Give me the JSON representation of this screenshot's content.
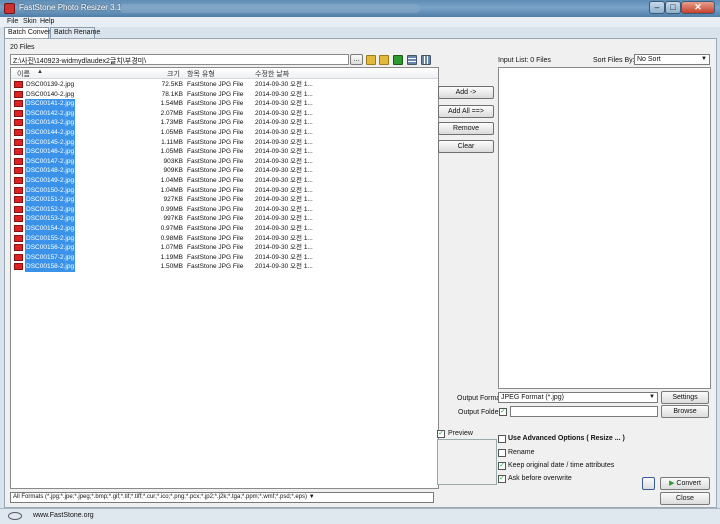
{
  "window": {
    "title": "FastStone Photo Resizer 3.1",
    "close_glyph": "✕",
    "min_glyph": "–",
    "max_glyph": "□"
  },
  "menu": [
    "File",
    "Skin",
    "Help"
  ],
  "tabs": [
    "Batch Convert",
    "Batch Rename"
  ],
  "file_count": "20 Files",
  "path": "Z:\\사진\\140923-widmydlaudex2글치\\부경미\\",
  "browse_label": "...",
  "columns": {
    "name": "이름",
    "size": "크기",
    "type": "항목 유형",
    "date": "수정한 날짜",
    "sort_glyph": "▲"
  },
  "files": [
    {
      "name": "DSC00139-2.jpg",
      "size": "72.5KB",
      "type": "FastStone JPG File",
      "date": "2014-09-30 오전 1...",
      "selected": false
    },
    {
      "name": "DSC00140-2.jpg",
      "size": "78.1KB",
      "type": "FastStone JPG File",
      "date": "2014-09-30 오전 1...",
      "selected": false
    },
    {
      "name": "DSC00141-2.jpg",
      "size": "1.54MB",
      "type": "FastStone JPG File",
      "date": "2014-09-30 오전 1...",
      "selected": true
    },
    {
      "name": "DSC00142-2.jpg",
      "size": "2.07MB",
      "type": "FastStone JPG File",
      "date": "2014-09-30 오전 1...",
      "selected": true
    },
    {
      "name": "DSC00143-2.jpg",
      "size": "1.73MB",
      "type": "FastStone JPG File",
      "date": "2014-09-30 오전 1...",
      "selected": true
    },
    {
      "name": "DSC00144-2.jpg",
      "size": "1.05MB",
      "type": "FastStone JPG File",
      "date": "2014-09-30 오전 1...",
      "selected": true
    },
    {
      "name": "DSC00145-2.jpg",
      "size": "1.11MB",
      "type": "FastStone JPG File",
      "date": "2014-09-30 오전 1...",
      "selected": true
    },
    {
      "name": "DSC00146-2.jpg",
      "size": "1.05MB",
      "type": "FastStone JPG File",
      "date": "2014-09-30 오전 1...",
      "selected": true
    },
    {
      "name": "DSC00147-2.jpg",
      "size": "903KB",
      "type": "FastStone JPG File",
      "date": "2014-09-30 오전 1...",
      "selected": true
    },
    {
      "name": "DSC00148-2.jpg",
      "size": "909KB",
      "type": "FastStone JPG File",
      "date": "2014-09-30 오전 1...",
      "selected": true
    },
    {
      "name": "DSC00149-2.jpg",
      "size": "1.04MB",
      "type": "FastStone JPG File",
      "date": "2014-09-30 오전 1...",
      "selected": true
    },
    {
      "name": "DSC00150-2.jpg",
      "size": "1.04MB",
      "type": "FastStone JPG File",
      "date": "2014-09-30 오전 1...",
      "selected": true
    },
    {
      "name": "DSC00151-2.jpg",
      "size": "927KB",
      "type": "FastStone JPG File",
      "date": "2014-09-30 오전 1...",
      "selected": true
    },
    {
      "name": "DSC00152-2.jpg",
      "size": "0.99MB",
      "type": "FastStone JPG File",
      "date": "2014-09-30 오전 1...",
      "selected": true
    },
    {
      "name": "DSC00153-2.jpg",
      "size": "997KB",
      "type": "FastStone JPG File",
      "date": "2014-09-30 오전 1...",
      "selected": true
    },
    {
      "name": "DSC00154-2.jpg",
      "size": "0.97MB",
      "type": "FastStone JPG File",
      "date": "2014-09-30 오전 1...",
      "selected": true
    },
    {
      "name": "DSC00155-2.jpg",
      "size": "0.98MB",
      "type": "FastStone JPG File",
      "date": "2014-09-30 오전 1...",
      "selected": true
    },
    {
      "name": "DSC00156-2.jpg",
      "size": "1.07MB",
      "type": "FastStone JPG File",
      "date": "2014-09-30 오전 1...",
      "selected": true
    },
    {
      "name": "DSC00157-2.jpg",
      "size": "1.19MB",
      "type": "FastStone JPG File",
      "date": "2014-09-30 오전 1...",
      "selected": true
    },
    {
      "name": "DSC00158-2.jpg",
      "size": "1.50MB",
      "type": "FastStone JPG File",
      "date": "2014-09-30 오전 1...",
      "selected": true
    }
  ],
  "buttons": {
    "add": "Add ->",
    "add_all": "Add All ==>",
    "remove": "Remove",
    "clear": "Clear"
  },
  "input_list_label": "Input List:  0 Files",
  "sort": {
    "label": "Sort Files By:",
    "value": "No Sort"
  },
  "output": {
    "format_label": "Output Format:",
    "format_value": "JPEG Format (*.jpg)",
    "settings": "Settings",
    "folder_label": "Output Folder:",
    "browse": "Browse"
  },
  "options": {
    "preview": "Preview",
    "advanced": "Use Advanced Options ( Resize ... )",
    "rename": "Rename",
    "keep_date": "Keep original date / time attributes",
    "ask_overwrite": "Ask before overwrite"
  },
  "check_glyph": "✓",
  "convert": "Convert",
  "close": "Close",
  "format_filter": "All Formats (*.jpg;*.jpe;*.jpeg;*.bmp;*.gif;*.tif;*.tiff;*.cur;*.ico;*.png;*.pcx;*.jp2;*.j2k;*.tga;*.ppm;*.wmf;*.psd;*.eps)",
  "status_url": "www.FastStone.org"
}
